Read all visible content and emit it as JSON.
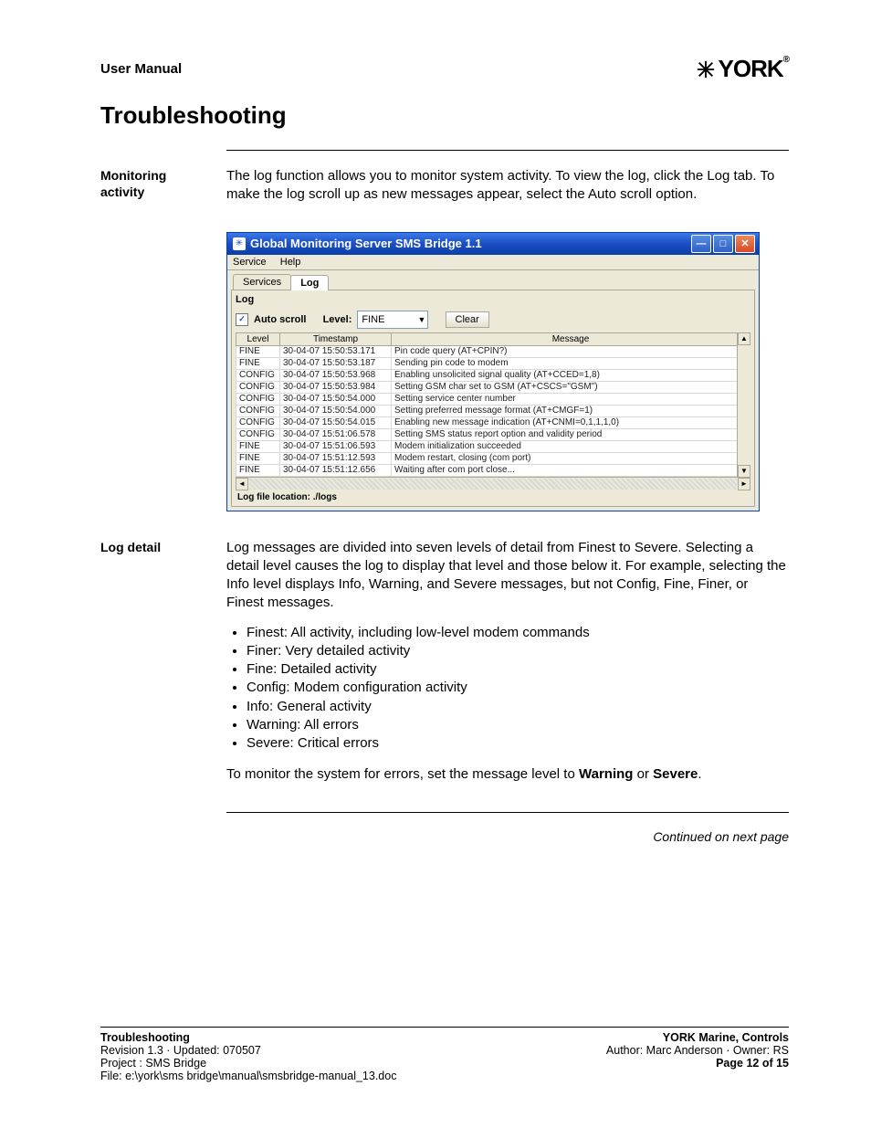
{
  "header": {
    "title": "User Manual",
    "logo_text": "YORK"
  },
  "section": {
    "title": "Troubleshooting"
  },
  "monitoring": {
    "label_line1": "Monitoring",
    "label_line2": "activity",
    "para": "The log function allows you to monitor system activity. To view the log, click the Log tab. To make the log scroll up as new messages appear, select the Auto scroll option."
  },
  "app": {
    "title": "Global Monitoring Server SMS Bridge 1.1",
    "menu": {
      "service": "Service",
      "help": "Help"
    },
    "tabs": {
      "services": "Services",
      "log": "Log"
    },
    "panel_label": "Log",
    "toolbar": {
      "auto_scroll": "Auto scroll",
      "level_label": "Level:",
      "level_value": "FINE",
      "clear": "Clear"
    },
    "columns": {
      "level": "Level",
      "timestamp": "Timestamp",
      "message": "Message"
    },
    "rows": [
      {
        "level": "FINE",
        "ts": "30-04-07 15:50:53.171",
        "msg": "Pin code query (AT+CPIN?)"
      },
      {
        "level": "FINE",
        "ts": "30-04-07 15:50:53.187",
        "msg": "Sending pin code to modem"
      },
      {
        "level": "CONFIG",
        "ts": "30-04-07 15:50:53.968",
        "msg": "Enabling unsolicited signal quality (AT+CCED=1,8)"
      },
      {
        "level": "CONFIG",
        "ts": "30-04-07 15:50:53.984",
        "msg": "Setting GSM char set to GSM (AT+CSCS=\"GSM\")"
      },
      {
        "level": "CONFIG",
        "ts": "30-04-07 15:50:54.000",
        "msg": "Setting service center number"
      },
      {
        "level": "CONFIG",
        "ts": "30-04-07 15:50:54.000",
        "msg": "Setting preferred message format (AT+CMGF=1)"
      },
      {
        "level": "CONFIG",
        "ts": "30-04-07 15:50:54.015",
        "msg": "Enabling new message indication (AT+CNMI=0,1,1,1,0)"
      },
      {
        "level": "CONFIG",
        "ts": "30-04-07 15:51:06.578",
        "msg": "Setting SMS status report option and validity period"
      },
      {
        "level": "FINE",
        "ts": "30-04-07 15:51:06.593",
        "msg": "Modem initialization succeeded"
      },
      {
        "level": "FINE",
        "ts": "30-04-07 15:51:12.593",
        "msg": "Modem restart, closing (com port)"
      },
      {
        "level": "FINE",
        "ts": "30-04-07 15:51:12.656",
        "msg": "Waiting after com port close..."
      }
    ],
    "status": "Log file location: ./logs"
  },
  "logdetail": {
    "label": "Log detail",
    "para": "Log messages are divided into seven levels of detail from Finest to Severe. Selecting a detail level causes the log to display that level and those below it. For example, selecting the Info level displays Info, Warning, and Severe messages, but not Config, Fine, Finer, or Finest messages.",
    "items": [
      "Finest: All activity, including low-level modem commands",
      "Finer: Very detailed activity",
      "Fine: Detailed activity",
      "Config: Modem configuration activity",
      "Info: General activity",
      "Warning: All errors",
      "Severe: Critical errors"
    ],
    "closing_pre": "To monitor the system for errors, set the message level to ",
    "closing_b1": "Warning",
    "closing_mid": " or ",
    "closing_b2": "Severe",
    "closing_post": "."
  },
  "continued": "Continued on next page",
  "footer": {
    "l1": "Troubleshooting",
    "l2": "Revision 1.3  ·  Updated: 070507",
    "l3": "Project : SMS Bridge",
    "l4": "File: e:\\york\\sms bridge\\manual\\smsbridge-manual_13.doc",
    "r1": "YORK Marine, Controls",
    "r2": "Author: Marc Anderson  ·  Owner: RS",
    "r3": "Page 12 of 15"
  }
}
